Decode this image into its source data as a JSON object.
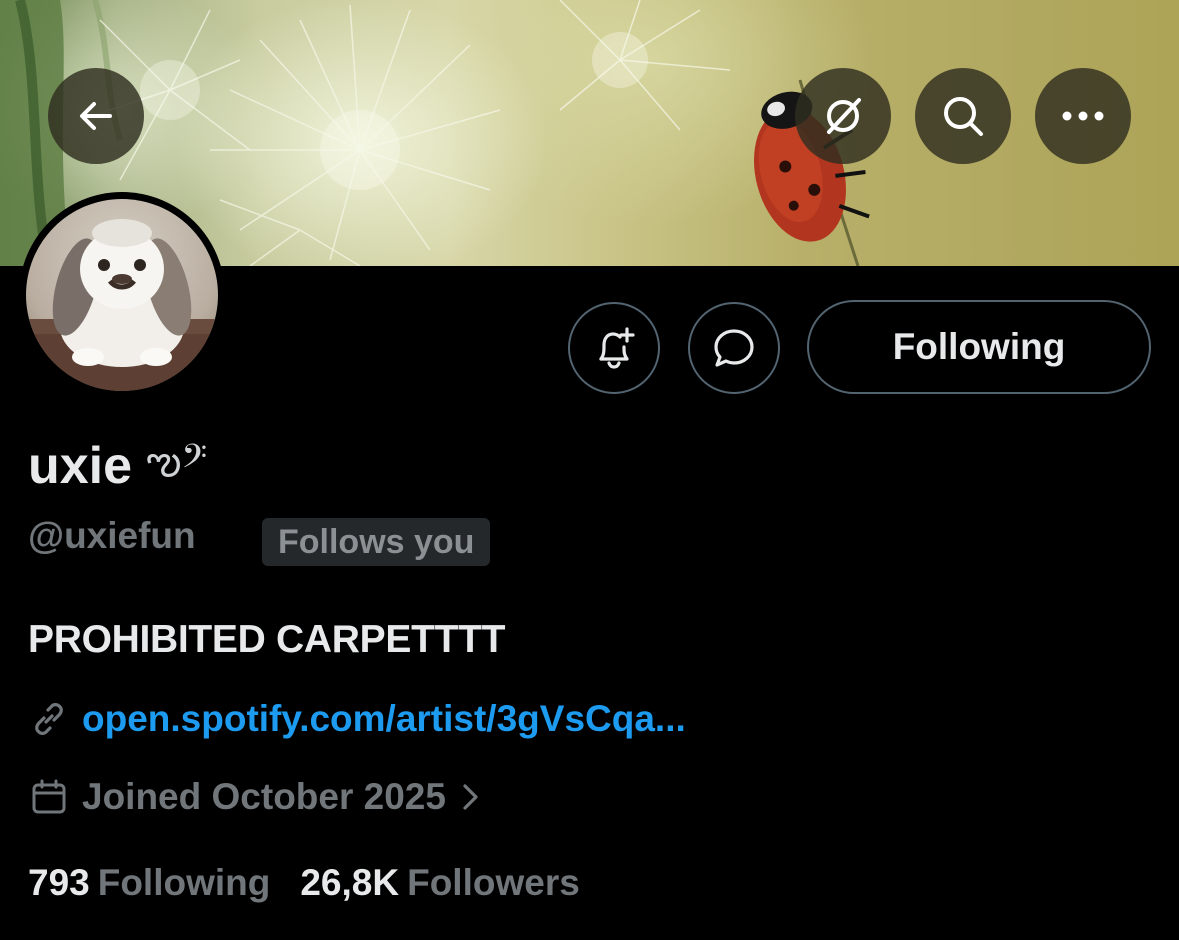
{
  "header": {
    "back_icon": "arrow-left-icon",
    "grok_icon": "grok-icon",
    "search_icon": "search-icon",
    "more_icon": "more-horizontal-icon"
  },
  "profile": {
    "display_name": "uxie",
    "name_emoji": "ఌ𝄢",
    "handle": "@uxiefun",
    "follows_you_badge": "Follows you",
    "bio": "PROHIBITED CARPETTTT",
    "link": "open.spotify.com/artist/3gVsCqa...",
    "joined": "Joined October 2025"
  },
  "actions": {
    "notify_icon": "bell-plus-icon",
    "message_icon": "message-bubble-icon",
    "following_label": "Following"
  },
  "stats": {
    "following_count": "793",
    "following_label": "Following",
    "followers_count": "26,8K",
    "followers_label": "Followers"
  },
  "colors": {
    "background": "#000000",
    "text_primary": "#e7e9ea",
    "text_secondary": "#71767b",
    "link": "#1d9bf0",
    "border": "#536471"
  }
}
